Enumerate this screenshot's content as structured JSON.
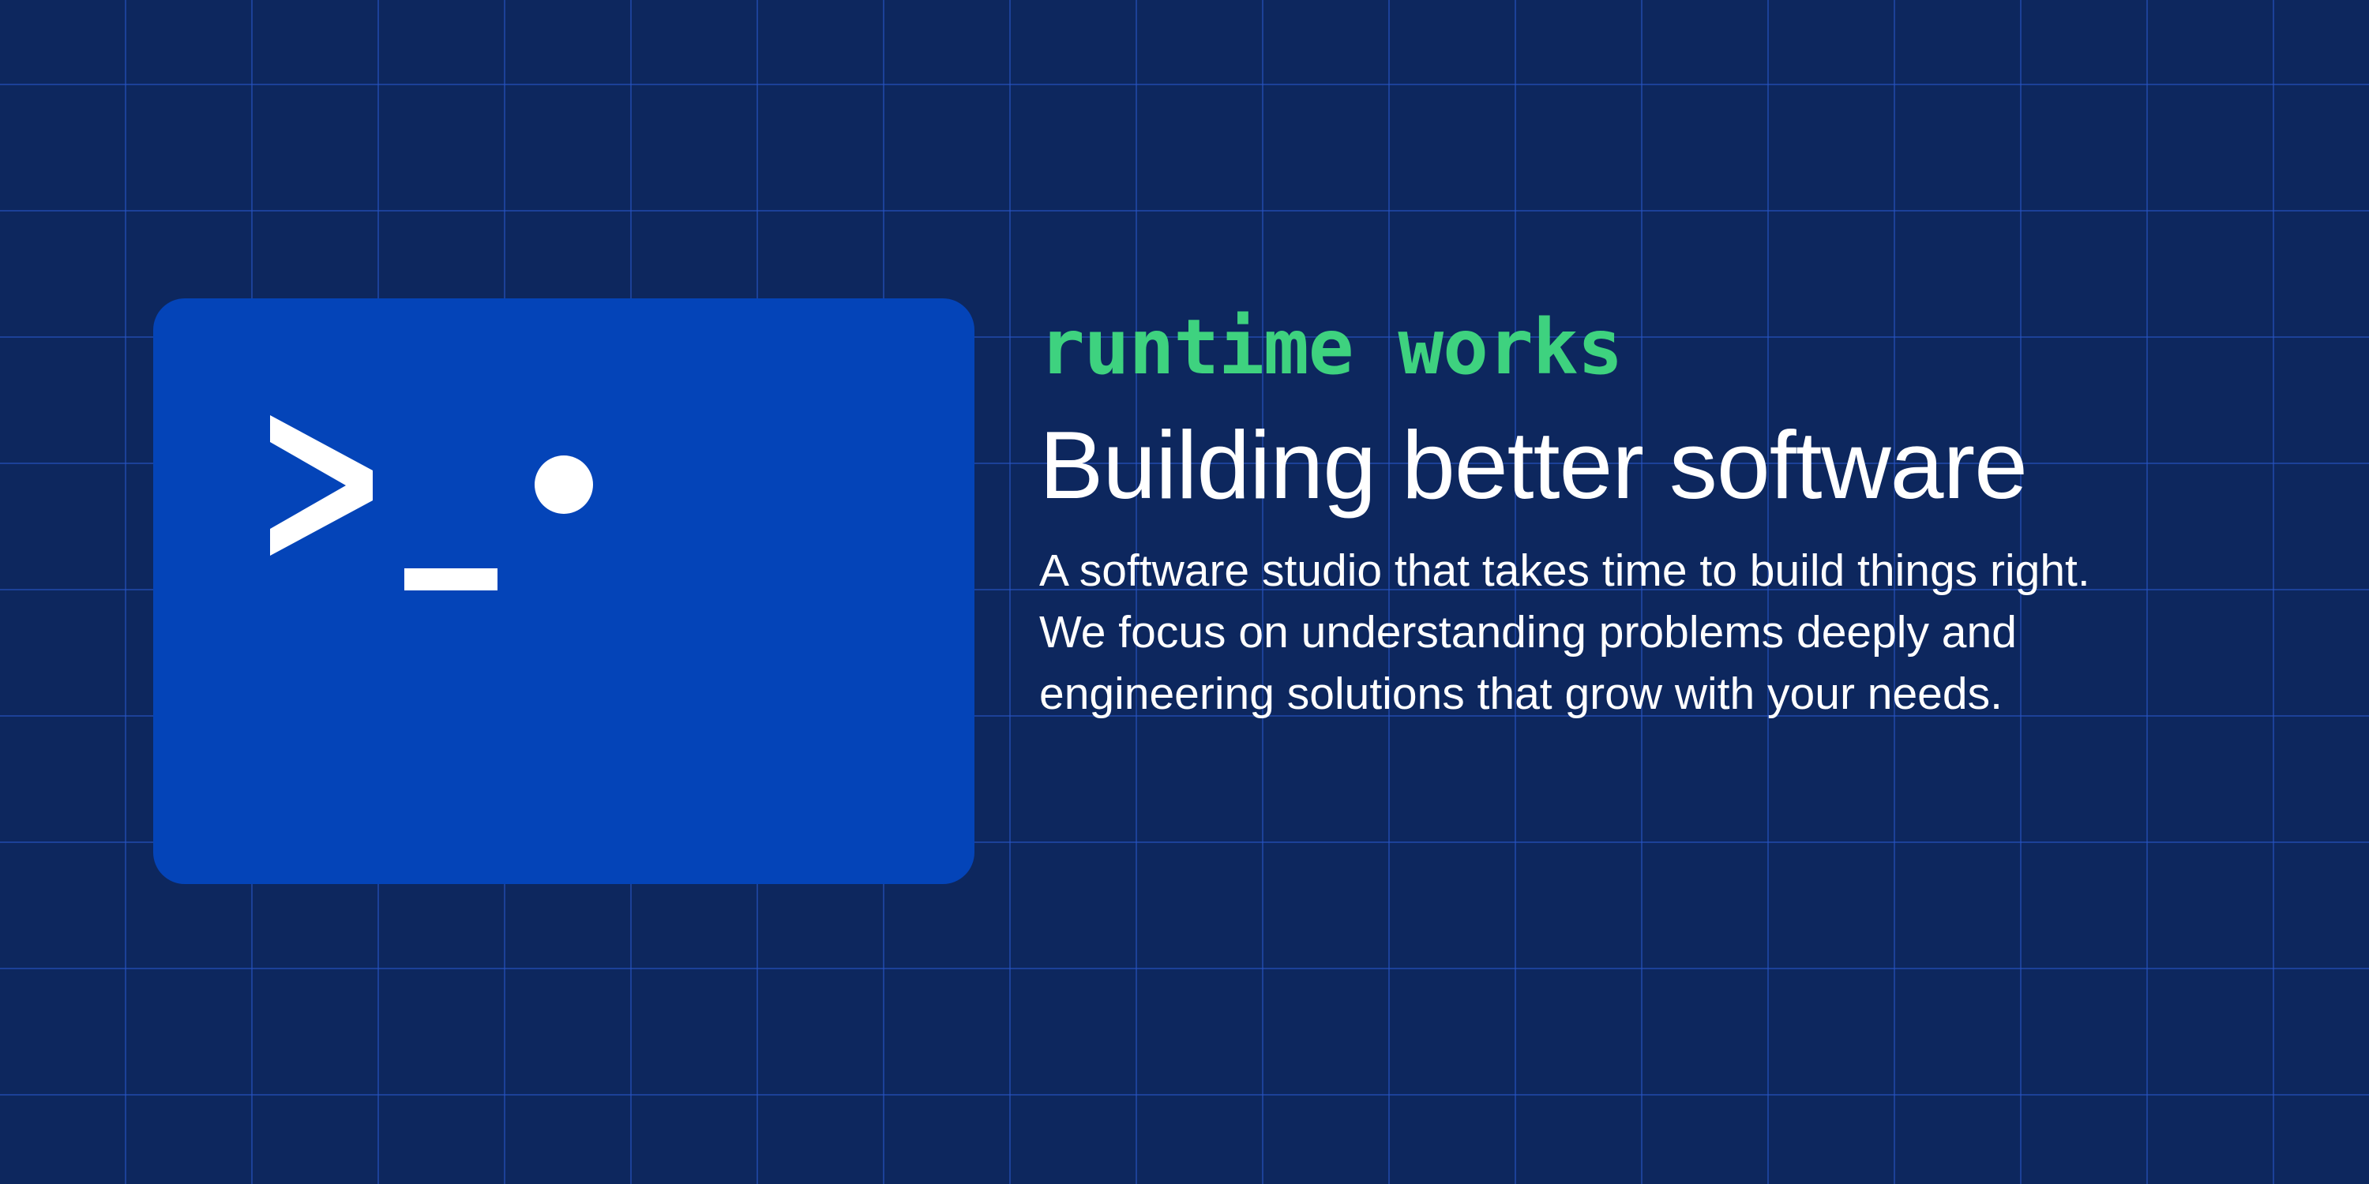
{
  "brand": {
    "name": "runtime works",
    "logo_icon": "terminal-prompt-icon"
  },
  "hero": {
    "headline": "Building better software",
    "description_lines": [
      "A software studio that takes time to build things right.",
      "We focus on understanding problems deeply and",
      "engineering solutions that grow with your needs."
    ]
  },
  "colors": {
    "background": "#0d275e",
    "grid_line": "#2856c8",
    "card": "#0444b8",
    "accent": "#3ed27f",
    "text": "#ffffff"
  }
}
